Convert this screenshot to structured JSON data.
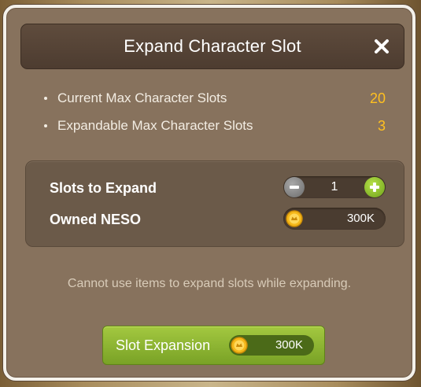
{
  "dialog": {
    "title": "Expand Character Slot"
  },
  "info": [
    {
      "label": "Current Max Character Slots",
      "value": "20"
    },
    {
      "label": "Expandable Max Character Slots",
      "value": "3"
    }
  ],
  "expand": {
    "slots_label": "Slots to Expand",
    "slots_value": "1",
    "neso_label": "Owned NESO",
    "neso_value": "300K"
  },
  "notice": "Cannot use items to expand slots while expanding.",
  "action": {
    "label": "Slot Expansion",
    "cost": "300K"
  },
  "icons": {
    "close": "close-icon",
    "minus": "minus-icon",
    "plus": "plus-icon",
    "neso": "neso-coin-icon"
  },
  "colors": {
    "highlight_value": "#ffc020",
    "button_green": "#8db536",
    "dialog_bg": "#87725d"
  }
}
